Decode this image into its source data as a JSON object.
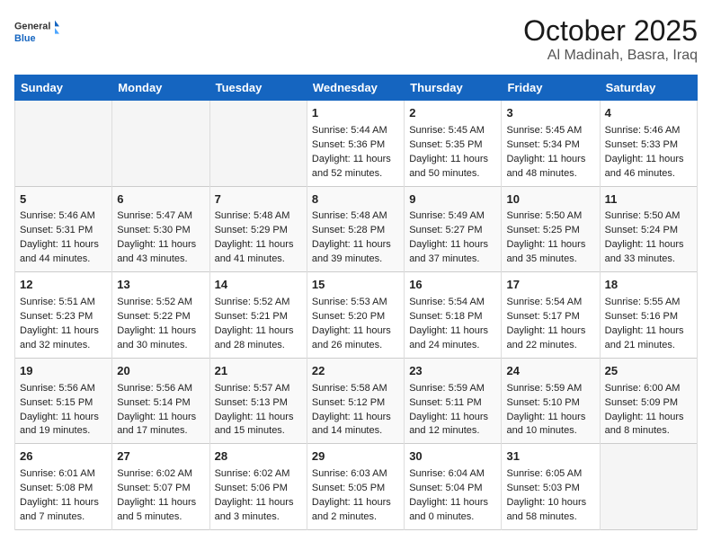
{
  "logo": {
    "line1": "General",
    "line2": "Blue"
  },
  "title": "October 2025",
  "location": "Al Madinah, Basra, Iraq",
  "days_of_week": [
    "Sunday",
    "Monday",
    "Tuesday",
    "Wednesday",
    "Thursday",
    "Friday",
    "Saturday"
  ],
  "weeks": [
    [
      {
        "day": "",
        "data": ""
      },
      {
        "day": "",
        "data": ""
      },
      {
        "day": "",
        "data": ""
      },
      {
        "day": "1",
        "data": "Sunrise: 5:44 AM\nSunset: 5:36 PM\nDaylight: 11 hours\nand 52 minutes."
      },
      {
        "day": "2",
        "data": "Sunrise: 5:45 AM\nSunset: 5:35 PM\nDaylight: 11 hours\nand 50 minutes."
      },
      {
        "day": "3",
        "data": "Sunrise: 5:45 AM\nSunset: 5:34 PM\nDaylight: 11 hours\nand 48 minutes."
      },
      {
        "day": "4",
        "data": "Sunrise: 5:46 AM\nSunset: 5:33 PM\nDaylight: 11 hours\nand 46 minutes."
      }
    ],
    [
      {
        "day": "5",
        "data": "Sunrise: 5:46 AM\nSunset: 5:31 PM\nDaylight: 11 hours\nand 44 minutes."
      },
      {
        "day": "6",
        "data": "Sunrise: 5:47 AM\nSunset: 5:30 PM\nDaylight: 11 hours\nand 43 minutes."
      },
      {
        "day": "7",
        "data": "Sunrise: 5:48 AM\nSunset: 5:29 PM\nDaylight: 11 hours\nand 41 minutes."
      },
      {
        "day": "8",
        "data": "Sunrise: 5:48 AM\nSunset: 5:28 PM\nDaylight: 11 hours\nand 39 minutes."
      },
      {
        "day": "9",
        "data": "Sunrise: 5:49 AM\nSunset: 5:27 PM\nDaylight: 11 hours\nand 37 minutes."
      },
      {
        "day": "10",
        "data": "Sunrise: 5:50 AM\nSunset: 5:25 PM\nDaylight: 11 hours\nand 35 minutes."
      },
      {
        "day": "11",
        "data": "Sunrise: 5:50 AM\nSunset: 5:24 PM\nDaylight: 11 hours\nand 33 minutes."
      }
    ],
    [
      {
        "day": "12",
        "data": "Sunrise: 5:51 AM\nSunset: 5:23 PM\nDaylight: 11 hours\nand 32 minutes."
      },
      {
        "day": "13",
        "data": "Sunrise: 5:52 AM\nSunset: 5:22 PM\nDaylight: 11 hours\nand 30 minutes."
      },
      {
        "day": "14",
        "data": "Sunrise: 5:52 AM\nSunset: 5:21 PM\nDaylight: 11 hours\nand 28 minutes."
      },
      {
        "day": "15",
        "data": "Sunrise: 5:53 AM\nSunset: 5:20 PM\nDaylight: 11 hours\nand 26 minutes."
      },
      {
        "day": "16",
        "data": "Sunrise: 5:54 AM\nSunset: 5:18 PM\nDaylight: 11 hours\nand 24 minutes."
      },
      {
        "day": "17",
        "data": "Sunrise: 5:54 AM\nSunset: 5:17 PM\nDaylight: 11 hours\nand 22 minutes."
      },
      {
        "day": "18",
        "data": "Sunrise: 5:55 AM\nSunset: 5:16 PM\nDaylight: 11 hours\nand 21 minutes."
      }
    ],
    [
      {
        "day": "19",
        "data": "Sunrise: 5:56 AM\nSunset: 5:15 PM\nDaylight: 11 hours\nand 19 minutes."
      },
      {
        "day": "20",
        "data": "Sunrise: 5:56 AM\nSunset: 5:14 PM\nDaylight: 11 hours\nand 17 minutes."
      },
      {
        "day": "21",
        "data": "Sunrise: 5:57 AM\nSunset: 5:13 PM\nDaylight: 11 hours\nand 15 minutes."
      },
      {
        "day": "22",
        "data": "Sunrise: 5:58 AM\nSunset: 5:12 PM\nDaylight: 11 hours\nand 14 minutes."
      },
      {
        "day": "23",
        "data": "Sunrise: 5:59 AM\nSunset: 5:11 PM\nDaylight: 11 hours\nand 12 minutes."
      },
      {
        "day": "24",
        "data": "Sunrise: 5:59 AM\nSunset: 5:10 PM\nDaylight: 11 hours\nand 10 minutes."
      },
      {
        "day": "25",
        "data": "Sunrise: 6:00 AM\nSunset: 5:09 PM\nDaylight: 11 hours\nand 8 minutes."
      }
    ],
    [
      {
        "day": "26",
        "data": "Sunrise: 6:01 AM\nSunset: 5:08 PM\nDaylight: 11 hours\nand 7 minutes."
      },
      {
        "day": "27",
        "data": "Sunrise: 6:02 AM\nSunset: 5:07 PM\nDaylight: 11 hours\nand 5 minutes."
      },
      {
        "day": "28",
        "data": "Sunrise: 6:02 AM\nSunset: 5:06 PM\nDaylight: 11 hours\nand 3 minutes."
      },
      {
        "day": "29",
        "data": "Sunrise: 6:03 AM\nSunset: 5:05 PM\nDaylight: 11 hours\nand 2 minutes."
      },
      {
        "day": "30",
        "data": "Sunrise: 6:04 AM\nSunset: 5:04 PM\nDaylight: 11 hours\nand 0 minutes."
      },
      {
        "day": "31",
        "data": "Sunrise: 6:05 AM\nSunset: 5:03 PM\nDaylight: 10 hours\nand 58 minutes."
      },
      {
        "day": "",
        "data": ""
      }
    ]
  ]
}
